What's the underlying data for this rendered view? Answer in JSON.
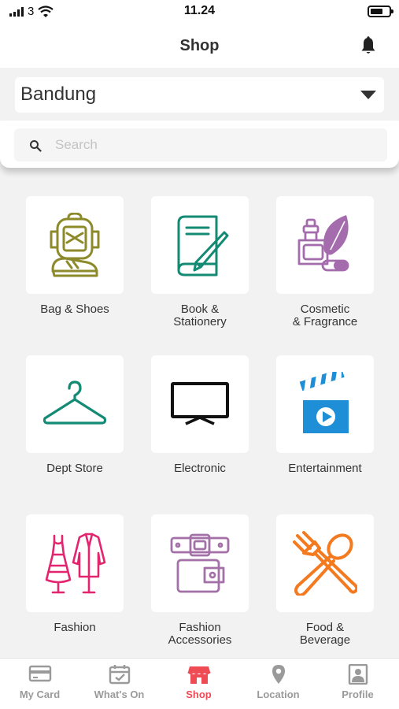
{
  "status_bar": {
    "carrier": "3",
    "time": "11.24",
    "battery_level": 0.7
  },
  "header": {
    "title": "Shop"
  },
  "city_select": {
    "value": "Bandung"
  },
  "search": {
    "placeholder": "Search",
    "value": ""
  },
  "categories": [
    {
      "label": "Bag & Shoes",
      "icon": "backpack-shoe-icon",
      "color": "#8c8a2a"
    },
    {
      "label": "Book &\nStationery",
      "icon": "book-pencil-icon",
      "color": "#138a73"
    },
    {
      "label": "Cosmetic\n& Fragrance",
      "icon": "perfume-leaf-icon",
      "color": "#a46bad"
    },
    {
      "label": "Dept Store",
      "icon": "hanger-icon",
      "color": "#138a73"
    },
    {
      "label": "Electronic",
      "icon": "tv-icon",
      "color": "#111111"
    },
    {
      "label": "Entertainment",
      "icon": "clapperboard-icon",
      "color": "#1e8fd6"
    },
    {
      "label": "Fashion",
      "icon": "dress-jacket-icon",
      "color": "#e3246e"
    },
    {
      "label": "Fashion\nAccessories",
      "icon": "belt-wallet-icon",
      "color": "#a470a8"
    },
    {
      "label": "Food &\nBeverage",
      "icon": "fork-spoon-icon",
      "color": "#f47a20"
    }
  ],
  "tabs": [
    {
      "label": "My Card",
      "icon": "card-icon",
      "active": false
    },
    {
      "label": "What's On",
      "icon": "calendar-check-icon",
      "active": false
    },
    {
      "label": "Shop",
      "icon": "store-icon",
      "active": true
    },
    {
      "label": "Location",
      "icon": "location-pin-icon",
      "active": false
    },
    {
      "label": "Profile",
      "icon": "profile-icon",
      "active": false
    }
  ],
  "colors": {
    "accent": "#ef4b55",
    "inactive_tab": "#9a9a9a",
    "background": "#f2f2f2"
  }
}
